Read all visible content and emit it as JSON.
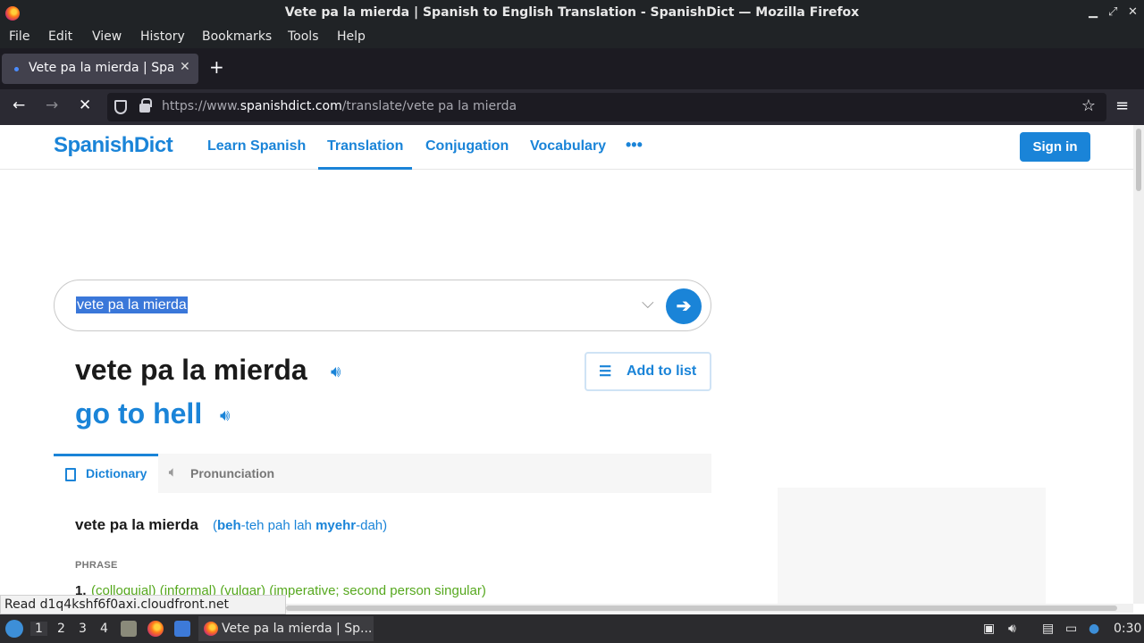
{
  "window": {
    "title": "Vete pa la mierda | Spanish to English Translation - SpanishDict — Mozilla Firefox"
  },
  "menubar": {
    "items": [
      "File",
      "Edit",
      "View",
      "History",
      "Bookmarks",
      "Tools",
      "Help"
    ]
  },
  "tabs": [
    {
      "label": "Vete pa la mierda | Spanish to English Translation - SpanishDict"
    }
  ],
  "navbar": {
    "url_prefix": "https://www.",
    "url_domain": "spanishdict.com",
    "url_path": "/translate/vete pa la mierda"
  },
  "site": {
    "logo": "SpanishDict",
    "nav": [
      "Learn Spanish",
      "Translation",
      "Conjugation",
      "Vocabulary"
    ],
    "more": "•••",
    "signin": "Sign in"
  },
  "search": {
    "value": "vete pa la mierda"
  },
  "result": {
    "headword": "vete pa la mierda",
    "translation": "go to hell",
    "add_to_list": "Add to list"
  },
  "content_tabs": {
    "dictionary": "Dictionary",
    "pronunciation": "Pronunciation"
  },
  "entry": {
    "term": "vete pa la mierda",
    "pron_1": "beh",
    "pron_2": "-teh pah lah ",
    "pron_3": "myehr",
    "pron_4": "-dah",
    "pos": "PHRASE",
    "sense_number": "1.",
    "sense_tags": "(colloquial) (informal) (vulgar) (imperative; second person singular)"
  },
  "status": {
    "text": "Read d1q4kshf6f0axi.cloudfront.net"
  },
  "taskbar": {
    "workspaces": [
      "1",
      "2",
      "3",
      "4"
    ],
    "task_label": "Vete pa la mierda | Sp...",
    "clock": "0:30"
  }
}
